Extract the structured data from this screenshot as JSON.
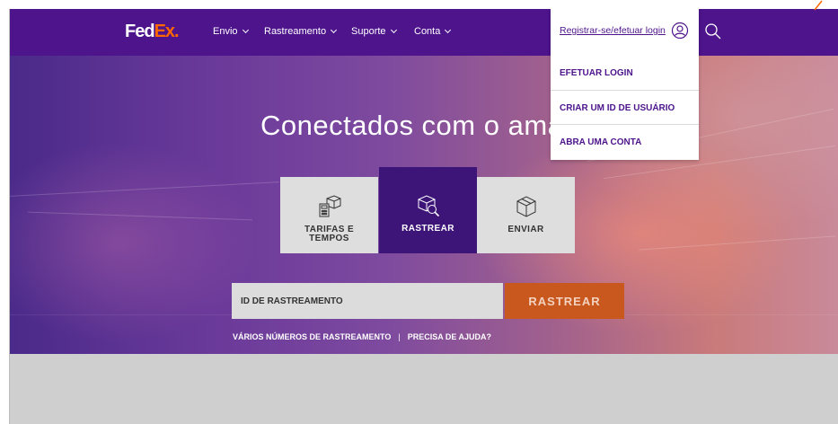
{
  "brand": {
    "logo_fed": "Fed",
    "logo_ex": "Ex",
    "logo_dot": "."
  },
  "nav": {
    "items": [
      {
        "label": "Envio"
      },
      {
        "label": "Rastreamento"
      },
      {
        "label": "Suporte"
      },
      {
        "label": "Conta"
      }
    ],
    "login_label": "Registrar-se/efetuar login",
    "search_icon": "search-icon"
  },
  "login_menu": {
    "items": [
      {
        "label": "EFETUAR LOGIN"
      },
      {
        "label": "CRIAR UM ID DE USUÁRIO"
      },
      {
        "label": "ABRA UMA CONTA"
      }
    ]
  },
  "hero": {
    "headline": "Conectados com o ama"
  },
  "tiles": [
    {
      "label": "TARIFAS E\nTEMPOS",
      "icon": "calculator-box-icon",
      "active": false
    },
    {
      "label": "RASTREAR",
      "icon": "package-search-icon",
      "active": true
    },
    {
      "label": "ENVIAR",
      "icon": "box-icon",
      "active": false
    }
  ],
  "tracking": {
    "placeholder": "ID DE RASTREAMENTO",
    "button_label": "RASTREAR",
    "multi_link": "VÁRIOS NÚMEROS DE RASTREAMENTO",
    "separator": "|",
    "help_link": "PRECISA DE AJUDA?"
  },
  "colors": {
    "brand_purple": "#4d148c",
    "brand_orange": "#ff6600",
    "track_button": "#c8581e"
  }
}
